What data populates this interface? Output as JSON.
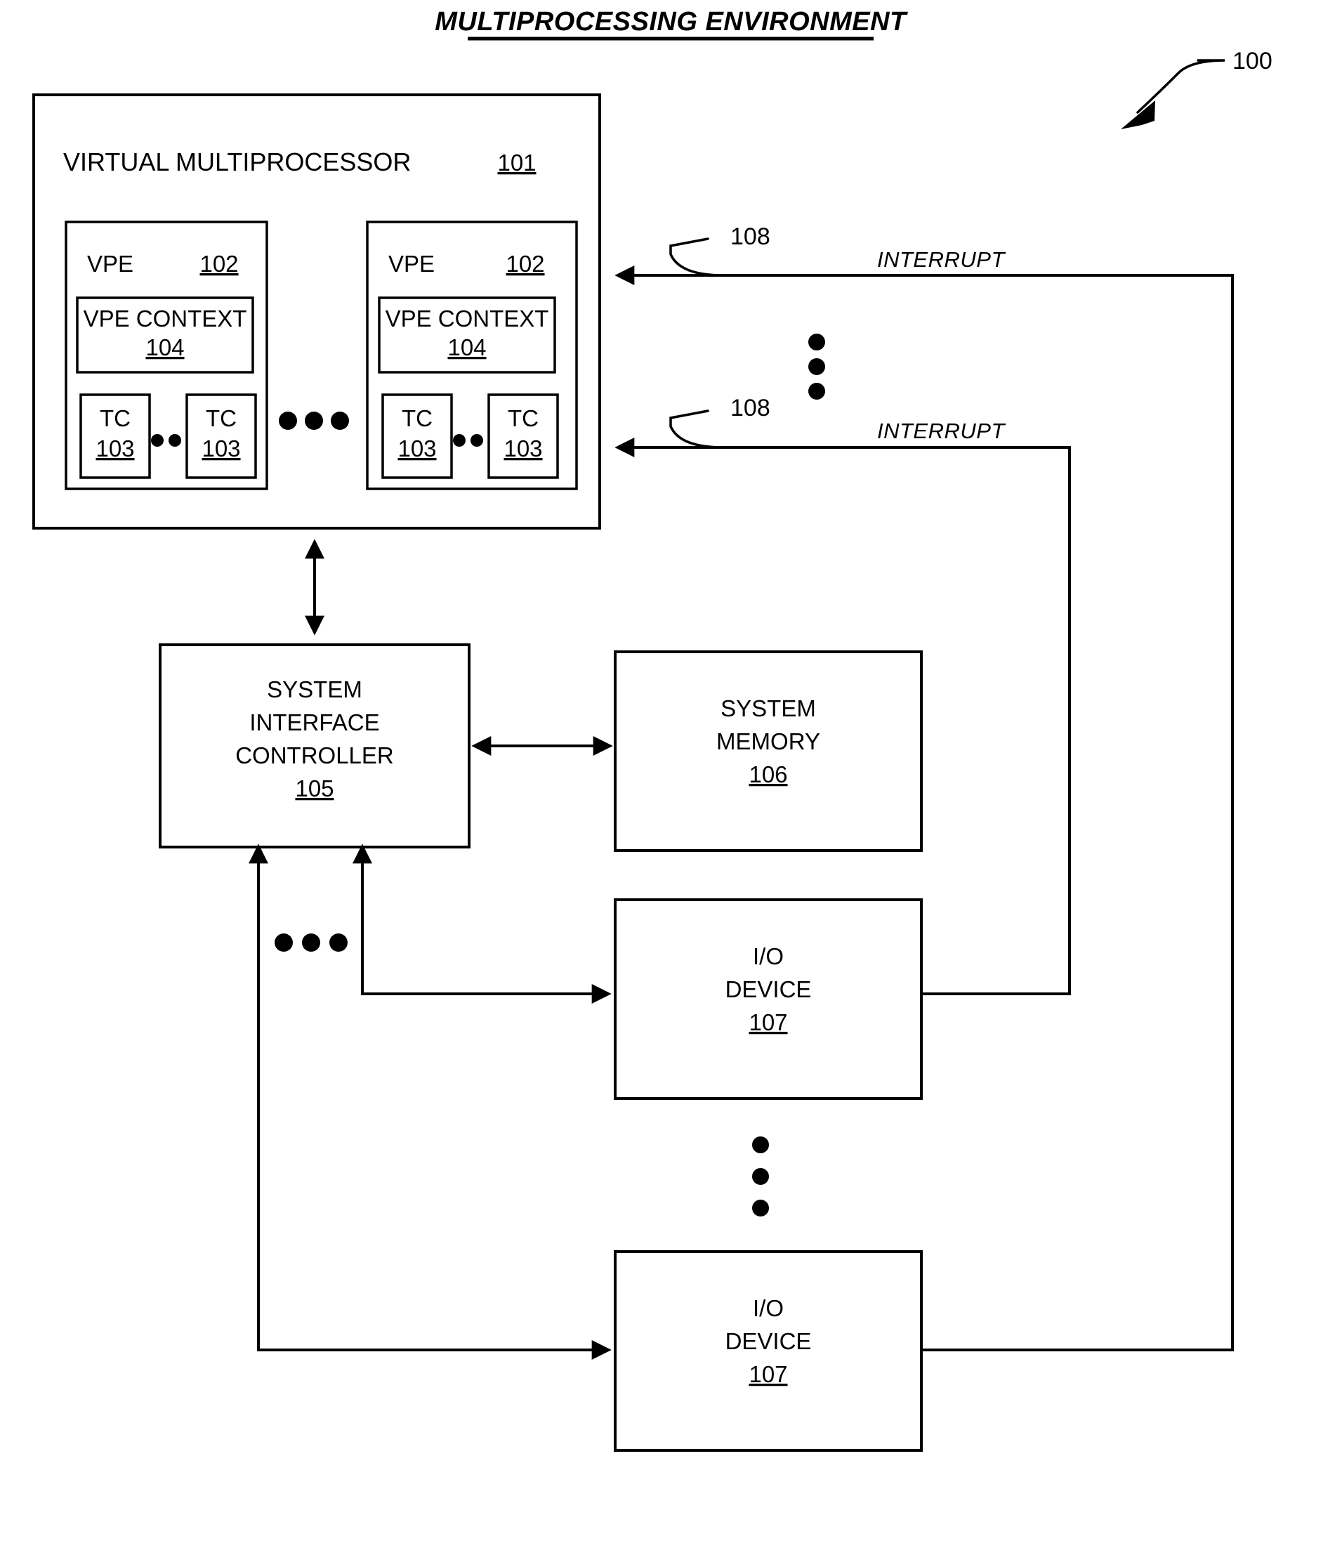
{
  "figure": {
    "title": "MULTIPROCESSING ENVIRONMENT",
    "figure_ref": "100"
  },
  "virtual_multiprocessor": {
    "label": "VIRTUAL MULTIPROCESSOR",
    "ref": "101",
    "vpes": [
      {
        "label": "VPE",
        "ref": "102",
        "context": {
          "label": "VPE CONTEXT",
          "ref": "104"
        },
        "tcs": [
          {
            "label": "TC",
            "ref": "103"
          },
          {
            "label": "TC",
            "ref": "103"
          }
        ],
        "tc_ellipsis": "• • •"
      },
      {
        "label": "VPE",
        "ref": "102",
        "context": {
          "label": "VPE CONTEXT",
          "ref": "104"
        },
        "tcs": [
          {
            "label": "TC",
            "ref": "103"
          },
          {
            "label": "TC",
            "ref": "103"
          }
        ],
        "tc_ellipsis": "• • •"
      }
    ],
    "vpe_ellipsis": "• • •"
  },
  "interrupts": [
    {
      "label": "INTERRUPT",
      "ref": "108"
    },
    {
      "label": "INTERRUPT",
      "ref": "108"
    }
  ],
  "interrupt_ellipsis": "vertical-three-dots",
  "system_interface_controller": {
    "line1": "SYSTEM",
    "line2": "INTERFACE",
    "line3": "CONTROLLER",
    "ref": "105"
  },
  "system_memory": {
    "line1": "SYSTEM",
    "line2": "MEMORY",
    "ref": "106"
  },
  "io_devices": [
    {
      "line1": "I/O",
      "line2": "DEVICE",
      "ref": "107"
    },
    {
      "line1": "I/O",
      "line2": "DEVICE",
      "ref": "107"
    }
  ],
  "io_bus_ellipsis": "• • •",
  "io_device_ellipsis": "vertical-three-dots",
  "colors": {
    "stroke": "#000000",
    "background": "#ffffff",
    "text": "#000000"
  }
}
